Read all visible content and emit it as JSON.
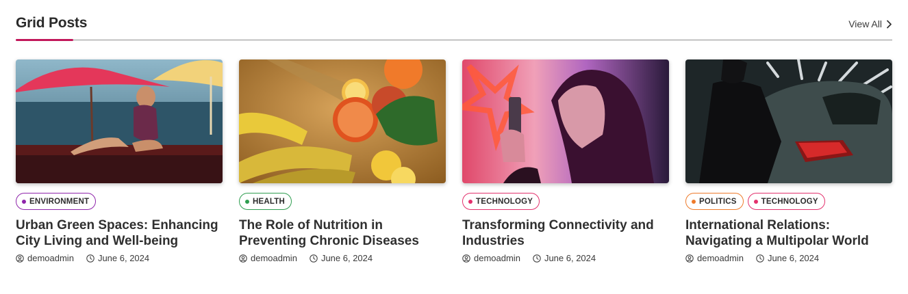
{
  "section": {
    "title": "Grid Posts",
    "view_all": "View All",
    "accent_color": "#c2185b"
  },
  "posts": [
    {
      "image_alt": "Woman sitting by a poolside with red umbrellas",
      "tags": [
        {
          "label": "ENVIRONMENT",
          "color": "#8e24aa"
        }
      ],
      "title": "Urban Green Spaces: Enhancing City Living and Well-being",
      "author": "demoadmin",
      "date": "June 6, 2024"
    },
    {
      "image_alt": "Fruits, bananas and oranges on a table",
      "tags": [
        {
          "label": "HEALTH",
          "color": "#2e9d4f"
        }
      ],
      "title": "The Role of Nutrition in Preventing Chronic Diseases",
      "author": "demoadmin",
      "date": "June 6, 2024"
    },
    {
      "image_alt": "Woman with pink hair looking at a phone under neon light",
      "tags": [
        {
          "label": "TECHNOLOGY",
          "color": "#e3306c"
        }
      ],
      "title": "Transforming Connectivity and Industries",
      "author": "demoadmin",
      "date": "June 6, 2024"
    },
    {
      "image_alt": "Woman in black standing beside a car",
      "tags": [
        {
          "label": "POLITICS",
          "color": "#ee7a2a"
        },
        {
          "label": "TECHNOLOGY",
          "color": "#e3306c"
        }
      ],
      "title": "International Relations: Navigating a Multipolar World",
      "author": "demoadmin",
      "date": "June 6, 2024"
    }
  ]
}
